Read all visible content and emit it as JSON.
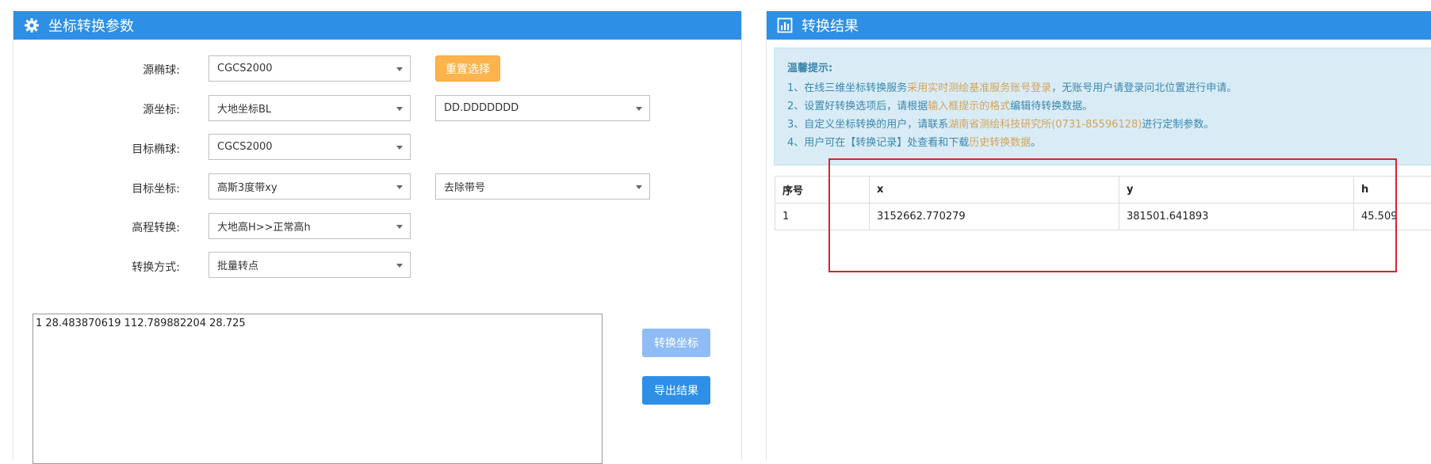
{
  "left_panel": {
    "title": "坐标转换参数",
    "rows": [
      {
        "label": "源椭球:",
        "select": "CGCS2000"
      },
      {
        "label": "源坐标:",
        "select": "大地坐标BL",
        "select2": "DD.DDDDDDD"
      },
      {
        "label": "目标椭球:",
        "select": "CGCS2000"
      },
      {
        "label": "目标坐标:",
        "select": "高斯3度带xy",
        "select2": "去除带号"
      },
      {
        "label": "高程转换:",
        "select": "大地高H>>正常高h"
      },
      {
        "label": "转换方式:",
        "select": "批量转点"
      }
    ],
    "reset_button": "重置选择",
    "input_text": "1 28.483870619 112.789882204 28.725",
    "convert_button": "转换坐标",
    "export_button": "导出结果"
  },
  "right_panel": {
    "title": "转换结果",
    "tips": {
      "title": "温馨提示:",
      "line1": {
        "a": "1、在线三维坐标转换服务",
        "b": "采用实时测绘基准服务账号登录",
        "c": "，无账号用户请登录问北位置进行申请。"
      },
      "line2": {
        "a": "2、设置好转换选项后，请根据",
        "b": "输入框提示的格式",
        "c": "编辑待转换数据。"
      },
      "line3": {
        "a": "3、自定义坐标转换的用户，请联系",
        "b": "湖南省测绘科技研究所(0731-85596128)",
        "c": "进行定制参数。"
      },
      "line4": {
        "a": "4、用户可在【转换记录】处查看和下载",
        "b": "历史转换数据",
        "c": "。"
      }
    },
    "table": {
      "headers": [
        "序号",
        "x",
        "y",
        "h"
      ],
      "rows": [
        [
          "1",
          "3152662.770279",
          "381501.641893",
          "45.509"
        ]
      ]
    }
  },
  "colors": {
    "header_blue": "#2d8fe6",
    "orange": "#fdb44d",
    "highlight_red": "#d9232d"
  }
}
